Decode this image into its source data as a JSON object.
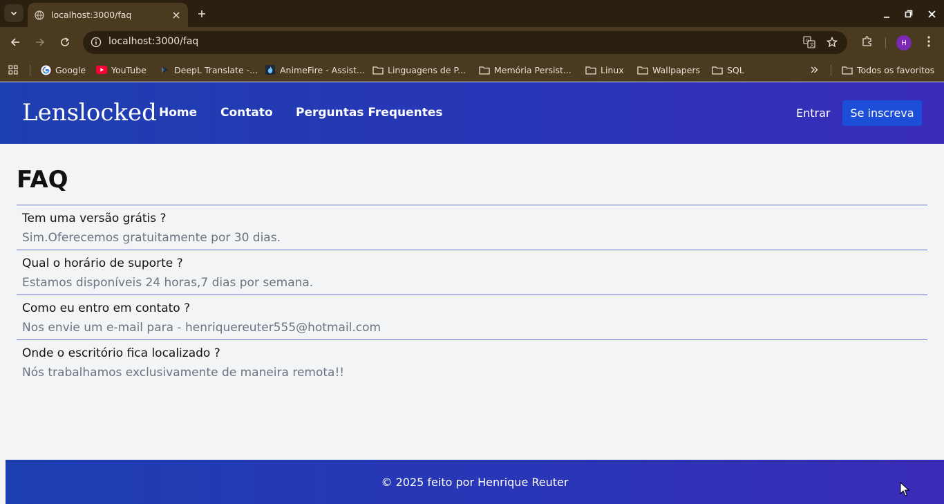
{
  "browser": {
    "tab_title": "localhost:3000/faq",
    "url": "localhost:3000/faq",
    "profile_initial": "H",
    "bookmarks": [
      {
        "label": "Google",
        "icon": "google-icon"
      },
      {
        "label": "YouTube",
        "icon": "youtube-icon"
      },
      {
        "label": "DeepL Translate -...",
        "icon": "deepl-icon"
      },
      {
        "label": "AnimeFire - Assist...",
        "icon": "animefire-icon"
      },
      {
        "label": "Linguagens de P...",
        "icon": "folder-icon"
      },
      {
        "label": "Memória Persist...",
        "icon": "folder-icon"
      },
      {
        "label": "Linux",
        "icon": "folder-icon"
      },
      {
        "label": "Wallpapers",
        "icon": "folder-icon"
      },
      {
        "label": "SQL",
        "icon": "folder-icon"
      }
    ],
    "all_bookmarks": "Todos os favoritos"
  },
  "header": {
    "brand": "Lenslocked",
    "nav": [
      "Home",
      "Contato",
      "Perguntas Frequentes"
    ],
    "login": "Entrar",
    "signup": "Se inscreva"
  },
  "faq": {
    "title": "FAQ",
    "items": [
      {
        "question": "Tem uma versão grátis ?",
        "answer": "Sim.Oferecemos gratuitamente por 30 dias."
      },
      {
        "question": "Qual o horário de suporte ?",
        "answer": "Estamos disponíveis 24 horas,7 dias por semana."
      },
      {
        "question": "Como eu entro em contato ?",
        "answer": "Nos envie um e-mail para - henriquereuter555@hotmail.com"
      },
      {
        "question": "Onde o escritório fica localizado ?",
        "answer": "Nós trabalhamos exclusivamente de maneira remota!!"
      }
    ]
  },
  "footer": {
    "text": "© 2025 feito por Henrique Reuter"
  },
  "colors": {
    "header_gradient_start": "#1e3fb0",
    "header_gradient_end": "#3a2cb8",
    "signup_button": "#1d4ed8",
    "page_background": "#f3f4f6",
    "divider": "#6b73c8"
  }
}
